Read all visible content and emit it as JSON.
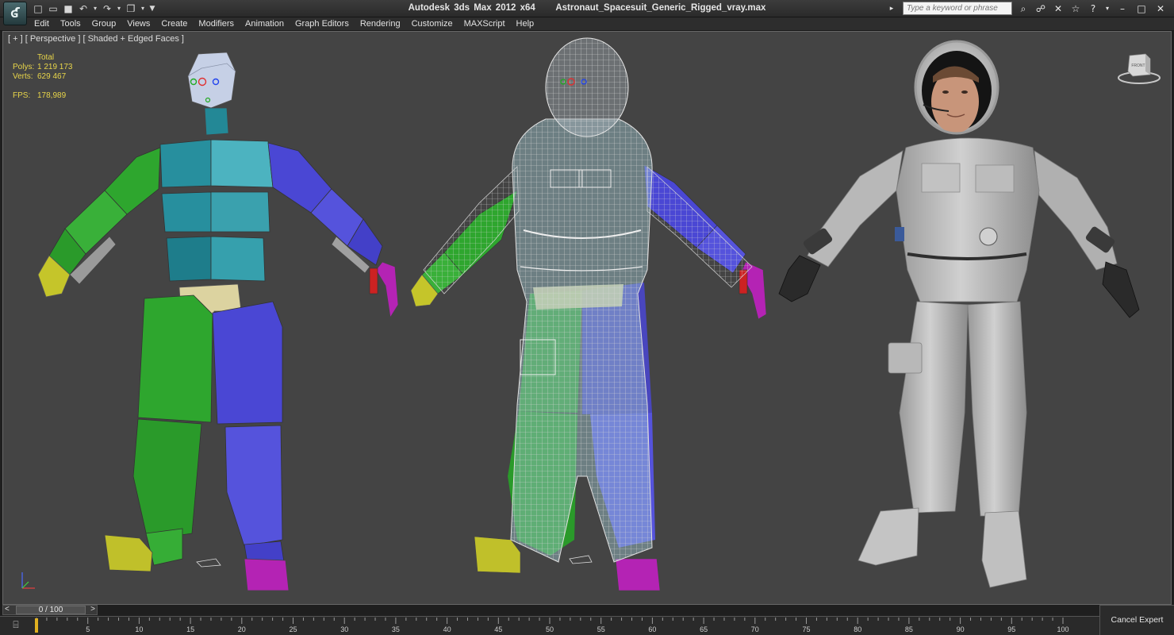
{
  "window": {
    "app_name": "Autodesk 3ds Max  2012 x64",
    "file_name": "Astronaut_Spacesuit_Generic_Rigged_vray.max"
  },
  "quick_access": [
    "new-file-icon",
    "open-file-icon",
    "save-icon",
    "undo-icon",
    "redo-icon",
    "project-icon"
  ],
  "search": {
    "placeholder": "Type a keyword or phrase"
  },
  "menu": [
    "Edit",
    "Tools",
    "Group",
    "Views",
    "Create",
    "Modifiers",
    "Animation",
    "Graph Editors",
    "Rendering",
    "Customize",
    "MAXScript",
    "Help"
  ],
  "viewport": {
    "label": "[ + ] [ Perspective ] [ Shaded + Edged Faces ]",
    "stats": {
      "header": "Total",
      "polys_label": "Polys:",
      "polys_value": "1 219 173",
      "verts_label": "Verts:",
      "verts_value": "629 467",
      "fps_label": "FPS:",
      "fps_value": "178,989"
    },
    "viewcube_label": "FRONT"
  },
  "timeline": {
    "frame_display": "0 / 100",
    "prev": "<",
    "next": ">",
    "current_frame": 0,
    "total_frames": 100,
    "ticks": [
      5,
      10,
      15,
      20,
      25,
      30,
      35,
      40,
      45,
      50,
      55,
      60,
      65,
      70,
      75,
      80,
      85,
      90,
      95,
      100
    ]
  },
  "status": {
    "cancel_expert_label": "Cancel Expert Mode"
  },
  "colors": {
    "viewport_bg": "#444444",
    "teal": "#2e9aa8",
    "green": "#2ea62e",
    "blue": "#4a47d4",
    "yellow": "#b8b826",
    "magenta": "#b423b4",
    "tan": "#dcd3a0",
    "stats_text": "#e8d54a"
  }
}
